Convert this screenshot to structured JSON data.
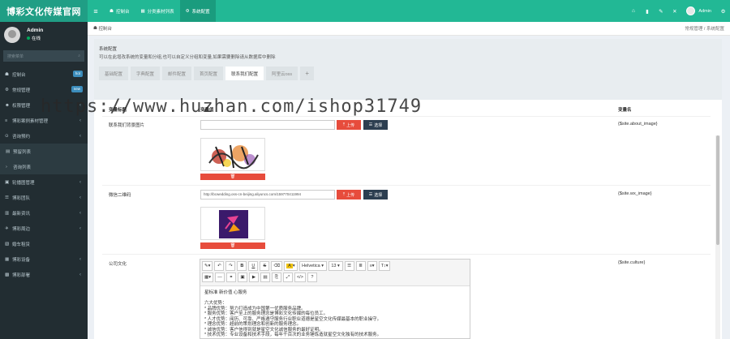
{
  "brand": {
    "logo": "博彩文化传媒官网"
  },
  "topbar": {
    "items": [
      {
        "icon": "≡",
        "label": ""
      },
      {
        "icon": "☗",
        "label": "控制台"
      },
      {
        "icon": "▦",
        "label": "分类素材列表"
      },
      {
        "icon": "⚙",
        "label": "系统配置"
      }
    ],
    "user": "Admin"
  },
  "sidebar": {
    "user": {
      "name": "Admin",
      "status": "在线"
    },
    "search_placeholder": "搜索菜单",
    "items": [
      {
        "icon": "☗",
        "label": "控制台",
        "badge": "hot",
        "badge_color": "#3c8dbc"
      },
      {
        "icon": "⚙",
        "label": "常规管理",
        "badge": "new",
        "badge_color": "#3c8dbc"
      },
      {
        "icon": "☻",
        "label": "权限管理",
        "chev": "‹"
      },
      {
        "icon": "≡",
        "label": "博彩案例素材管理",
        "chev": "‹"
      },
      {
        "icon": "⊙",
        "label": "咨询预约",
        "chev": "‹"
      },
      {
        "icon": "▤",
        "label": "预留列表",
        "sub": true
      },
      {
        "icon": "›",
        "label": "咨询列表",
        "sub": true
      },
      {
        "icon": "▣",
        "label": "轮播图管理",
        "chev": "‹"
      },
      {
        "icon": "☰",
        "label": "博彩团队",
        "chev": "‹"
      },
      {
        "icon": "▥",
        "label": "最新资讯",
        "chev": "‹"
      },
      {
        "icon": "✈",
        "label": "博彩周边",
        "chev": "‹"
      },
      {
        "icon": "▧",
        "label": "婚车租赁",
        "chev": ""
      },
      {
        "icon": "▦",
        "label": "博彩设备",
        "chev": "‹"
      },
      {
        "icon": "▩",
        "label": "博彩部署",
        "chev": "‹"
      }
    ]
  },
  "breadcrumb": {
    "home": "控制台",
    "path": "常规管理 / 系统配置"
  },
  "panel": {
    "title": "系统配置",
    "desc": "可以在此增改系统的变量和分组,也可以自定义分组和变量,如果需要删除请从数据库中删除",
    "tabs": [
      "基础配置",
      "字典配置",
      "邮件配置",
      "首页配置",
      "联系我们配置",
      "阿里云oss",
      "+"
    ],
    "active_tab": 4
  },
  "table": {
    "headers": [
      "变量标题",
      "变量值",
      "变量名"
    ],
    "rows": [
      {
        "label": "联系我们背景图片",
        "value": "",
        "name": "{$site.about_image}"
      },
      {
        "label": "微信二维码",
        "value": "http://bcwedding.oss-cn-beijing.aliyuncs.com/159770411994",
        "name": "{$site.wx_image}"
      },
      {
        "label": "公司文化",
        "value": "",
        "name": "{$site.culture}"
      }
    ],
    "upload_label": "上传",
    "select_label": "选择",
    "delete_icon": "🗑"
  },
  "editor": {
    "font": "Helvetica",
    "size": "13",
    "content": [
      "星标准 新价值 心服务",
      "",
      "六大优势：",
      "* 品牌优势：努力打造成为中国第一优质服务品牌。",
      "* 服务优势：客户至上的服务理念是博彩文化传媒的每位员工。",
      "* 人才优势：阅历、可靠、严格遵守服务行业职业道德是星空文化传媒最基本的职业操守。",
      "* 理念优势：超前的策划理念和创新的服务理念。",
      "* 诚信优势：客户信得到就是星空文化诚信服务的最好证明。",
      "* 技术优势：专业设备和技术手段，每年千百次的业务锤炼造就星空文化独有的技术服务。"
    ]
  },
  "watermark": "https://www.huzhan.com/ishop31749"
}
